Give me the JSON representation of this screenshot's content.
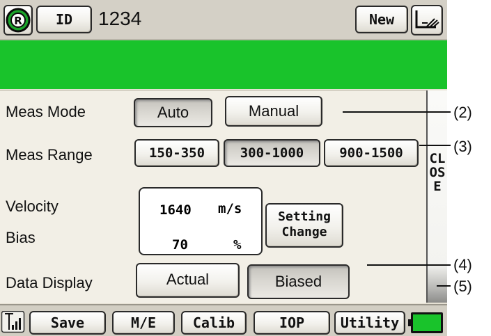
{
  "header": {
    "id_label": "ID",
    "id_value": "1234",
    "new_label": "New"
  },
  "meas_mode": {
    "label": "Meas Mode",
    "options": [
      "Auto",
      "Manual"
    ],
    "selected": "Auto"
  },
  "meas_range": {
    "label": "Meas Range",
    "options": [
      "150-350",
      "300-1000",
      "900-1500"
    ],
    "selected": "300-1000"
  },
  "velocity": {
    "label": "Velocity",
    "value": "1640",
    "unit": "m/s"
  },
  "bias": {
    "label": "Bias",
    "value": "70",
    "unit": "%"
  },
  "setting_change": {
    "line1": "Setting",
    "line2": "Change"
  },
  "data_display": {
    "label": "Data Display",
    "options": [
      "Actual",
      "Biased"
    ],
    "selected": "Biased"
  },
  "close_label": "CLOSE",
  "tabs": [
    "Save",
    "M/E",
    "Calib",
    "IOP",
    "Utility"
  ],
  "callouts": [
    "(2)",
    "(3)",
    "(4)",
    "(5)"
  ],
  "colors": {
    "status_bar": "#19c32b",
    "battery": "#19c32b",
    "logo": "#1aa32a"
  },
  "icons": {
    "logo": "r-logo-icon",
    "tool": "probe-tool-icon",
    "signal": "signal-strength-icon",
    "battery": "battery-icon"
  }
}
